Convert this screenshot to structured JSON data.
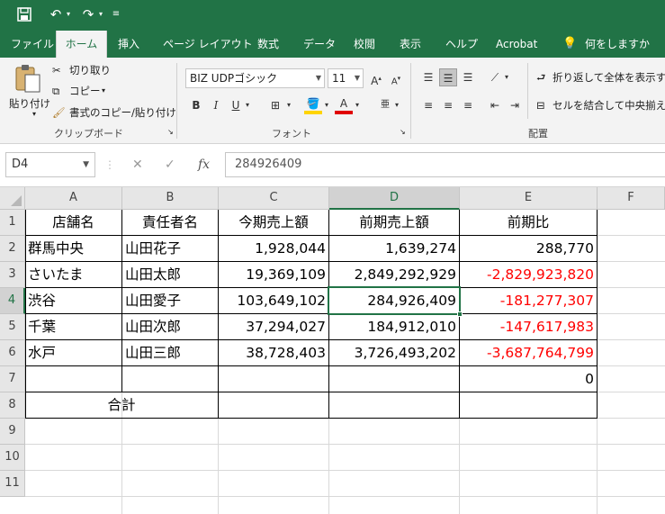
{
  "qat": {
    "save_icon": "save-icon",
    "undo_icon": "undo-icon",
    "redo_icon": "redo-icon",
    "customize_icon": "customize-qat-icon"
  },
  "tabs": [
    "ファイル",
    "ホーム",
    "挿入",
    "ページ レイアウト",
    "数式",
    "データ",
    "校閲",
    "表示",
    "ヘルプ",
    "Acrobat",
    "何をしますか"
  ],
  "active_tab": "ホーム",
  "ribbon": {
    "clipboard": {
      "paste": "貼り付け",
      "cut": "切り取り",
      "copy": "コピー",
      "format_painter": "書式のコピー/貼り付け",
      "group": "クリップボード"
    },
    "font": {
      "name": "BIZ UDPゴシック",
      "size": "11",
      "group": "フォント"
    },
    "alignment": {
      "wrap": "折り返して全体を表示する",
      "merge": "セルを結合して中央揃え",
      "group": "配置"
    }
  },
  "formula_bar": {
    "name_box": "D4",
    "formula": "284926409"
  },
  "columns": [
    "A",
    "B",
    "C",
    "D",
    "E",
    "F"
  ],
  "rows": [
    "1",
    "2",
    "3",
    "4",
    "5",
    "6",
    "7",
    "8",
    "9",
    "10",
    "11"
  ],
  "selected_cell": "D4",
  "sheet": {
    "headers": [
      "店舗名",
      "責任者名",
      "今期売上額",
      "前期売上額",
      "前期比"
    ],
    "data": [
      [
        "群馬中央",
        "山田花子",
        "1,928,044",
        "1,639,274",
        "288,770"
      ],
      [
        "さいたま",
        "山田太郎",
        "19,369,109",
        "2,849,292,929",
        "-2,829,923,820"
      ],
      [
        "渋谷",
        "山田愛子",
        "103,649,102",
        "284,926,409",
        "-181,277,307"
      ],
      [
        "千葉",
        "山田次郎",
        "37,294,027",
        "184,912,010",
        "-147,617,983"
      ],
      [
        "水戸",
        "山田三郎",
        "38,728,403",
        "3,726,493,202",
        "-3,687,764,799"
      ]
    ],
    "row7_e": "0",
    "total_label": "合計"
  },
  "colors": {
    "excel_green": "#217346",
    "negative": "#ff0000",
    "ribbon_bg": "#f3f3f3"
  }
}
